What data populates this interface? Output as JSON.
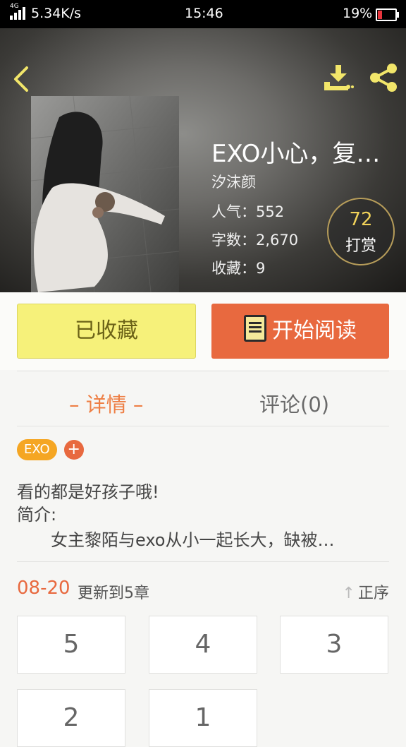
{
  "status_bar": {
    "network_type": "4G",
    "speed": "5.34K/s",
    "time": "15:46",
    "battery": "19%",
    "battery_level": 0.19
  },
  "header": {
    "back_icon": "chevron-left-icon",
    "download_icon": "download-icon",
    "share_icon": "share-icon"
  },
  "book": {
    "title": "EXO小心，复…",
    "author": "汐沫颜",
    "popularity": "人气：552",
    "word_count": "字数：2,670",
    "favorites": "收藏：9",
    "tip_count": "72",
    "tip_label": "打赏"
  },
  "actions": {
    "collected_label": "已收藏",
    "read_label": "开始阅读"
  },
  "tabs": {
    "detail": "– 详情 –",
    "comments": "评论(0)"
  },
  "tags": [
    "EXO"
  ],
  "tag_add": "+",
  "description": {
    "line1": "看的都是好孩子哦!",
    "line2": "简介:",
    "intro": "女主黎陌与exo从小一起长大，缺被…"
  },
  "update": {
    "date": "08-20",
    "text": "更新到5章",
    "order_label": "正序"
  },
  "chapters": [
    "5",
    "4",
    "3",
    "2",
    "1"
  ],
  "colors": {
    "accent_orange": "#e8693f",
    "tag_orange": "#f5a623",
    "collected_yellow": "#f6f17a",
    "icon_yellow": "#f2e66a"
  }
}
